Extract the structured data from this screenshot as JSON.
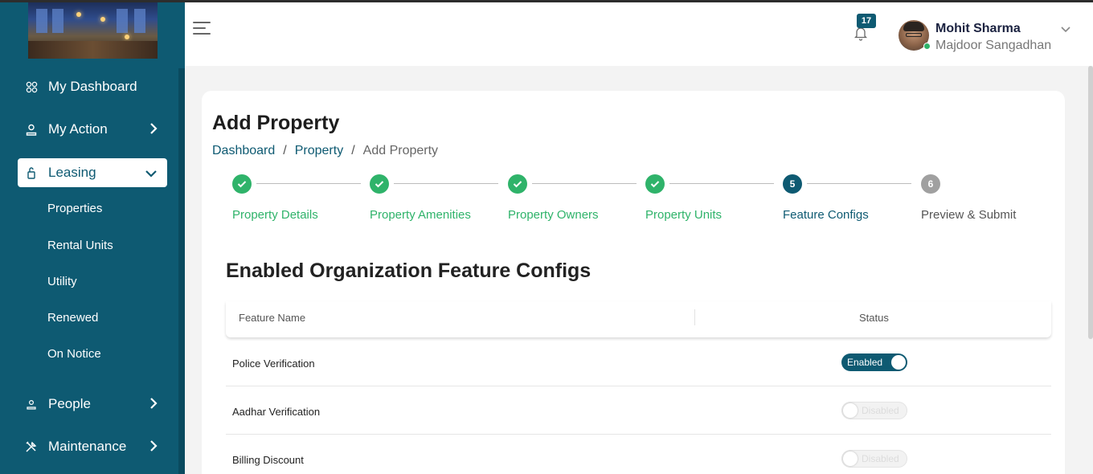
{
  "sidebar": {
    "items": [
      {
        "label": "My Dashboard",
        "icon": "grid-icon"
      },
      {
        "label": "My Action",
        "icon": "user-icon"
      },
      {
        "label": "Leasing",
        "icon": "key-icon"
      },
      {
        "label": "People",
        "icon": "person-icon"
      },
      {
        "label": "Maintenance",
        "icon": "tools-icon"
      }
    ],
    "leasing_subitems": [
      "Properties",
      "Rental Units",
      "Utility",
      "Renewed",
      "On Notice"
    ]
  },
  "header": {
    "notification_count": "17",
    "user_name": "Mohit Sharma",
    "user_org": "Majdoor Sangadhan"
  },
  "page": {
    "title": "Add Property",
    "breadcrumb": [
      "Dashboard",
      "Property",
      "Add Property"
    ]
  },
  "stepper": {
    "steps": [
      {
        "label": "Property Details",
        "marker": "",
        "state": "done"
      },
      {
        "label": "Property Amenities",
        "marker": "",
        "state": "done"
      },
      {
        "label": "Property Owners",
        "marker": "",
        "state": "done"
      },
      {
        "label": "Property Units",
        "marker": "",
        "state": "done"
      },
      {
        "label": "Feature Configs",
        "marker": "5",
        "state": "current"
      },
      {
        "label": "Preview & Submit",
        "marker": "6",
        "state": "todo"
      }
    ]
  },
  "feature_configs": {
    "title": "Enabled Organization Feature Configs",
    "columns": [
      "Feature Name",
      "Status"
    ],
    "rows": [
      {
        "name": "Police Verification",
        "status": "Enabled"
      },
      {
        "name": "Aadhar Verification",
        "status": "Disabled"
      },
      {
        "name": "Billing Discount",
        "status": "Disabled"
      }
    ]
  },
  "colors": {
    "primary": "#0e5a72",
    "success": "#2fb36a",
    "muted": "#a0a0a0"
  }
}
